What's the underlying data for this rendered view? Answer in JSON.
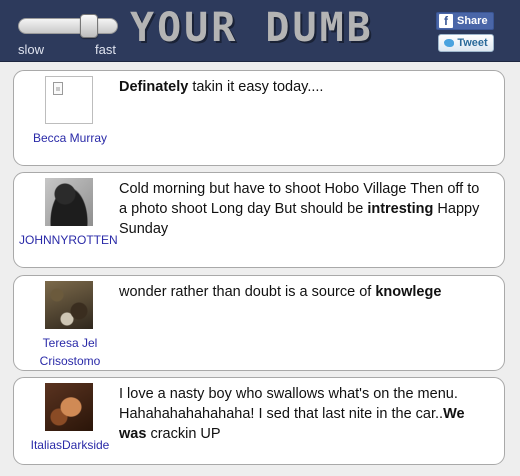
{
  "header": {
    "logo_text": "YOUR DUMB",
    "speed_slider": {
      "min_label": "slow",
      "max_label": "fast",
      "level": 0.75
    },
    "share_button": {
      "icon": "f",
      "label": "Share"
    },
    "tweet_button": {
      "label": "Tweet"
    },
    "colors": {
      "header_bg": "#2d3a5c",
      "logo": "#b4b4b4",
      "username_link": "#2a2aa8"
    }
  },
  "posts": [
    {
      "username": "Becca Murray",
      "avatar": "broken-image-icon",
      "text": [
        {
          "t": "Definately",
          "bold": true
        },
        {
          "t": " takin it easy today....",
          "bold": false
        }
      ]
    },
    {
      "username": "JOHNNYROTTEN",
      "avatar": "person-photo",
      "text": [
        {
          "t": "Cold morning but have to shoot Hobo Village Then off to a photo shoot Long day But should be ",
          "bold": false
        },
        {
          "t": "intresting",
          "bold": true
        },
        {
          "t": " Happy Sunday",
          "bold": false
        }
      ]
    },
    {
      "username": "Teresa Jel Crisostomo",
      "avatar": "photo",
      "text": [
        {
          "t": "wonder rather than doubt is a source of ",
          "bold": false
        },
        {
          "t": "knowlege",
          "bold": true
        }
      ]
    },
    {
      "username": "ItaliasDarkside",
      "avatar": "photo",
      "text": [
        {
          "t": "I love a nasty boy who swallows what's on the menu. Hahahahahahahaha! I sed that last nite in the car..",
          "bold": false
        },
        {
          "t": "We was",
          "bold": true
        },
        {
          "t": " crackin UP",
          "bold": false
        }
      ]
    }
  ]
}
